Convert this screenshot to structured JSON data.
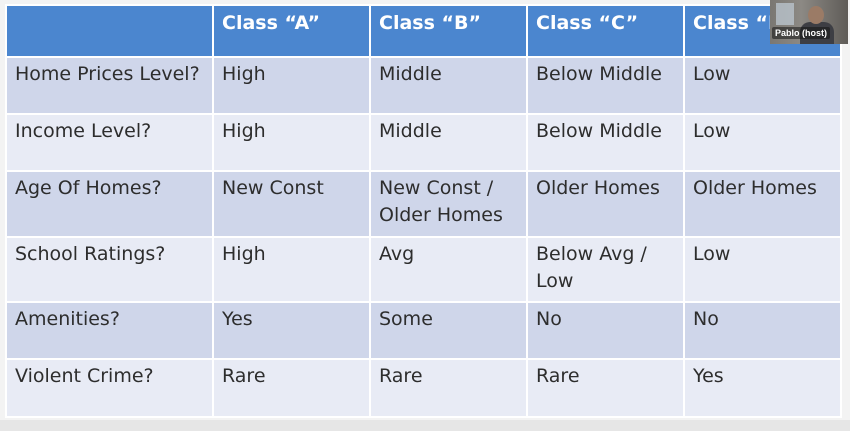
{
  "table": {
    "headers": [
      "",
      "Class “A”",
      "Class “B”",
      "Class “C”",
      "Class “D”"
    ],
    "rows": [
      {
        "label": "Home Prices Level?",
        "cells": [
          "High",
          "Middle",
          "Below Middle",
          "Low"
        ]
      },
      {
        "label": "Income Level?",
        "cells": [
          "High",
          "Middle",
          "Below Middle",
          "Low"
        ]
      },
      {
        "label": "Age Of Homes?",
        "cells": [
          "New Const",
          "New Const / Older Homes",
          "Older Homes",
          "Older Homes"
        ]
      },
      {
        "label": "School Ratings?",
        "cells": [
          "High",
          "Avg",
          "Below Avg / Low",
          "Low"
        ]
      },
      {
        "label": "Amenities?",
        "cells": [
          "Yes",
          "Some",
          "No",
          "No"
        ]
      },
      {
        "label": "Violent Crime?",
        "cells": [
          "Rare",
          "Rare",
          "Rare",
          "Yes"
        ]
      }
    ]
  },
  "webcam": {
    "name": "Pablo (host)"
  },
  "colors": {
    "header_bg": "#4b86cf",
    "row_alt_dark": "#cfd6ea",
    "row_alt_light": "#e8ebf5"
  }
}
